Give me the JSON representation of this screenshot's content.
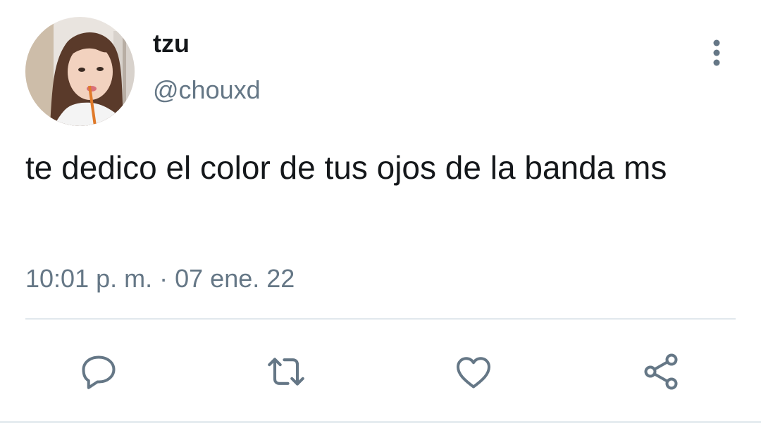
{
  "tweet": {
    "author": {
      "display_name": "tzu",
      "handle": "@chouxd"
    },
    "text": "te dedico el color de tus ojos de la banda ms",
    "time": "10:01 p. m.",
    "separator": "·",
    "date": "07 ene. 22"
  },
  "actions": [
    {
      "name": "reply",
      "icon": "reply-icon"
    },
    {
      "name": "retweet",
      "icon": "retweet-icon"
    },
    {
      "name": "like",
      "icon": "heart-icon"
    },
    {
      "name": "share",
      "icon": "share-icon"
    }
  ],
  "colors": {
    "text_primary": "#14171a",
    "text_secondary": "#657786",
    "icon": "#657786",
    "divider": "#e1e8ed"
  }
}
